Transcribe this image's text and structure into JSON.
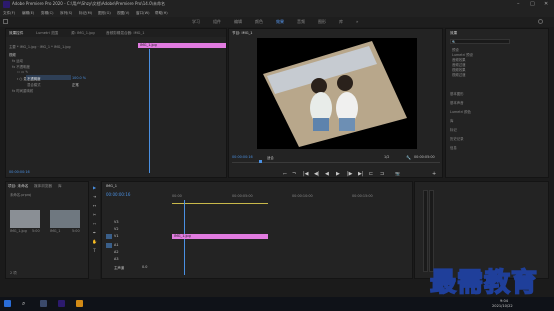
{
  "titlebar": {
    "title": "Adobe Premiere Pro 2020 - C:\\用户\\Shzy\\文档\\Adobe\\Premiere Pro\\14.0\\未命名",
    "min": "–",
    "max": "□",
    "close": "✕"
  },
  "menubar": {
    "items": [
      "文件(F)",
      "编辑(E)",
      "剪辑(C)",
      "序列(S)",
      "标记(M)",
      "图形(G)",
      "视图(V)",
      "窗口(W)",
      "帮助(H)"
    ]
  },
  "workspaces": {
    "tabs": [
      "学习",
      "组件",
      "编辑",
      "颜色",
      "效果",
      "音频",
      "图形",
      "库"
    ],
    "active_index": 4,
    "more": "»"
  },
  "source_panel": {
    "tabs": [
      "效果控件",
      "Lumetri 范围",
      "源: IMG_1.jpg",
      "音频剪辑混合器: IMG_1"
    ],
    "clip_path": "主要 * IMG_1.jpg  ·  IMG_1 * IMG_1.jpg",
    "clip_bar_label": "IMG_1.jpg",
    "section": "视频",
    "rows": [
      {
        "label": "fx  运动"
      },
      {
        "label": "fx  不透明度"
      },
      {
        "label": "⬭ ▭ ✎"
      },
      {
        "label": "›  ○ 混合模式"
      },
      {
        "label": "不透明度",
        "value": "100.0 %"
      },
      {
        "label": "混合模式",
        "value": "正常"
      },
      {
        "label": "fx  时间重映射"
      }
    ],
    "timecode": "00:00:00:16"
  },
  "program_monitor": {
    "tab": "节目: IMG_1",
    "timecode_left": "00:00:00:16",
    "fit": "适合",
    "quality": "1/2",
    "timecode_right": "00:00:05:00",
    "controls": [
      "⌐",
      "¬",
      "|◀",
      "◀|",
      "◀",
      "▶",
      "|▶",
      "▶|",
      "⊏",
      "⊐",
      "📷",
      "+"
    ]
  },
  "effects_panel": {
    "title": "效果",
    "search_placeholder": "🔍",
    "tree": [
      "预设",
      "Lumetri 预设",
      "音频效果",
      "音频过渡",
      "视频效果",
      "视频过渡"
    ],
    "sections": [
      "基本图形",
      "基本声音",
      "Lumetri 颜色",
      "库",
      "标记",
      "历史记录",
      "信息"
    ]
  },
  "project_panel": {
    "tabs": [
      "项目: 未命名",
      "媒体浏览器",
      "库"
    ],
    "file": "未命名.prproj",
    "thumbs": [
      {
        "name": "IMG_1.jpg",
        "dur": "5:00"
      },
      {
        "name": "IMG_1",
        "dur": "5:00"
      }
    ],
    "item_count": "2 项"
  },
  "timeline": {
    "tab": "IMG_1",
    "timecode": "00:00:00:16",
    "ruler": [
      "00:00",
      "00:00:05:00",
      "00:00:10:00",
      "00:00:15:00"
    ],
    "tracks": [
      {
        "name": "V3"
      },
      {
        "name": "V2"
      },
      {
        "name": "V1"
      },
      {
        "name": "A1"
      },
      {
        "name": "A2"
      },
      {
        "name": "A3"
      },
      {
        "name": "主声道",
        "value": "0.0"
      }
    ],
    "clip_label": "IMG_1.jpg"
  },
  "tools": [
    "▶",
    "⇥",
    "↔",
    "✂",
    "⇿",
    "✒",
    "✋",
    "T"
  ],
  "taskbar": {
    "search": "⌕",
    "time": "9:04",
    "date": "2021/10/22"
  },
  "watermark": {
    "text": "最需教育"
  },
  "colors": {
    "accent": "#4a90e2",
    "clip_pink": "#e17be0",
    "video_dark": "#000000",
    "tray": "#0f1218"
  }
}
